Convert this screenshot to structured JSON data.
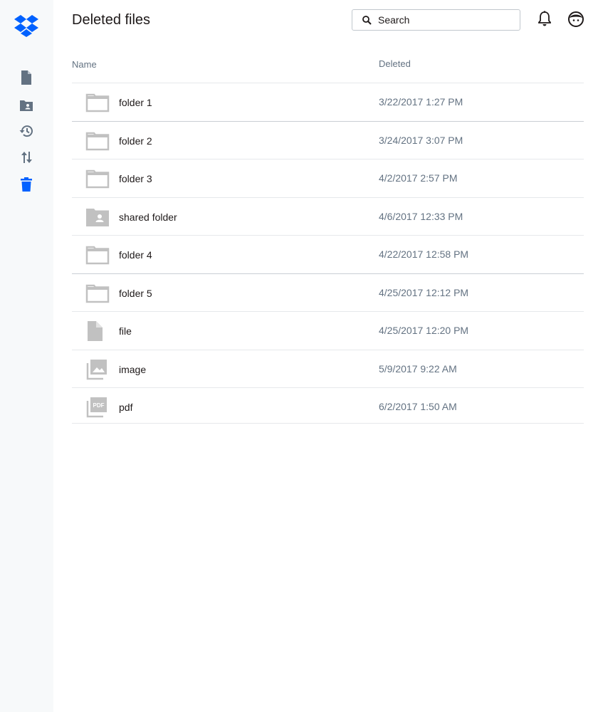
{
  "app": {
    "title": "Deleted files"
  },
  "colors": {
    "brand": "#0061ff",
    "icon_gray": "#c1c1c1",
    "nav_icon": "#637282",
    "sidebar_bg": "#f7f9fa"
  },
  "sidebar": {
    "items": [
      {
        "icon": "file-icon",
        "active": false
      },
      {
        "icon": "shared-folder-icon",
        "active": false
      },
      {
        "icon": "history-icon",
        "active": false
      },
      {
        "icon": "transfer-icon",
        "active": false
      },
      {
        "icon": "trash-icon",
        "active": true
      }
    ]
  },
  "search": {
    "placeholder": "Search"
  },
  "table": {
    "headers": {
      "name": "Name",
      "deleted": "Deleted"
    },
    "rows": [
      {
        "name": "folder 1",
        "deleted": "3/22/2017 1:27 PM",
        "type": "folder"
      },
      {
        "name": "folder 2",
        "deleted": "3/24/2017 3:07 PM",
        "type": "folder"
      },
      {
        "name": "folder 3",
        "deleted": "4/2/2017 2:57 PM",
        "type": "folder"
      },
      {
        "name": "shared folder",
        "deleted": "4/6/2017 12:33 PM",
        "type": "shared-folder"
      },
      {
        "name": "folder 4",
        "deleted": "4/22/2017 12:58 PM",
        "type": "folder"
      },
      {
        "name": "folder 5",
        "deleted": "4/25/2017 12:12 PM",
        "type": "folder"
      },
      {
        "name": "file",
        "deleted": "4/25/2017 12:20 PM",
        "type": "file"
      },
      {
        "name": "image",
        "deleted": "5/9/2017 9:22 AM",
        "type": "image"
      },
      {
        "name": "pdf",
        "deleted": "6/2/2017 1:50 AM",
        "type": "pdf",
        "badge": "PDF"
      }
    ]
  }
}
